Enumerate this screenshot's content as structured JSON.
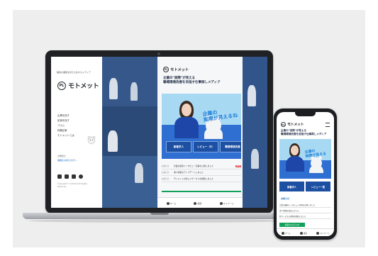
{
  "brand": {
    "logo_mark": "PL",
    "name": "モトメット"
  },
  "laptop": {
    "side": {
      "tagline": "職場の課題を見える化するメディア",
      "nav": [
        "企業を探す",
        "記事を探す",
        "コラム",
        "特集記事",
        "モトメットとは"
      ],
      "small1": "お問合せ",
      "small2": "掲載をお考えの方へ",
      "footer": "Copyright © motomet All Rights Reserved."
    },
    "center": {
      "headline_line1": "企業の\"実際\"が見える",
      "headline_line2": "職場環境改善を目指す仕事探しメディア",
      "hero_copy_line1": "企業の",
      "hero_copy_line2": "実際が見えるね",
      "categories": [
        "新着求人",
        "レビュー（5）",
        "職場環境改善"
      ],
      "news": [
        {
          "tag": "お知らせ",
          "title": "企業の最新インタビュー記事を公開しました",
          "badge": "NEW"
        },
        {
          "tag": "お知らせ",
          "title": "求人情報をアップデートしました",
          "badge": ""
        },
        {
          "tag": "お知らせ",
          "title": "モトメットの新しいサービスを開始しました",
          "badge": ""
        }
      ],
      "bottom_nav": [
        "ホーム",
        "検索",
        "マイページ"
      ]
    }
  },
  "phone": {
    "headline_line1": "企業の\"実際\"が見える",
    "headline_line2": "職場環境改善を目指す仕事探しメディア",
    "hero_copy_line1": "企業の",
    "hero_copy_line2": "実際が見える",
    "categories": [
      "新着求人",
      "レビュー一覧"
    ],
    "section": "お知らせ",
    "news": [
      {
        "tag": "",
        "title": "企業の最新インタビュー記事を公開しました"
      },
      {
        "tag": "",
        "title": "求人情報を追加しました"
      },
      {
        "tag": "",
        "title": "新サービスの提供を開始しました"
      }
    ],
    "green_button": "掲載をお考えの方",
    "bottom_nav": [
      "ホーム",
      "検索",
      "マイページ"
    ]
  },
  "colors": {
    "accent_blue": "#2f6fd2",
    "navy": "#1d4fa3",
    "green": "#13a05b",
    "sky": "#a8d9f3"
  }
}
